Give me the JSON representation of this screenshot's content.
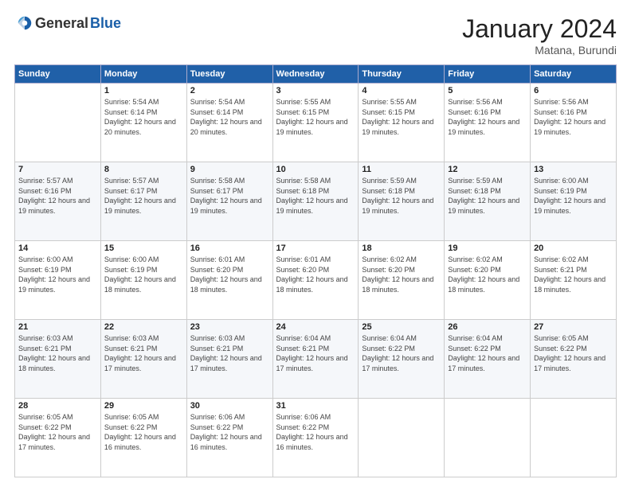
{
  "logo": {
    "general": "General",
    "blue": "Blue"
  },
  "title": "January 2024",
  "location": "Matana, Burundi",
  "weekdays": [
    "Sunday",
    "Monday",
    "Tuesday",
    "Wednesday",
    "Thursday",
    "Friday",
    "Saturday"
  ],
  "weeks": [
    [
      {
        "day": "",
        "sunrise": "",
        "sunset": "",
        "daylight": ""
      },
      {
        "day": "1",
        "sunrise": "Sunrise: 5:54 AM",
        "sunset": "Sunset: 6:14 PM",
        "daylight": "Daylight: 12 hours and 20 minutes."
      },
      {
        "day": "2",
        "sunrise": "Sunrise: 5:54 AM",
        "sunset": "Sunset: 6:14 PM",
        "daylight": "Daylight: 12 hours and 20 minutes."
      },
      {
        "day": "3",
        "sunrise": "Sunrise: 5:55 AM",
        "sunset": "Sunset: 6:15 PM",
        "daylight": "Daylight: 12 hours and 19 minutes."
      },
      {
        "day": "4",
        "sunrise": "Sunrise: 5:55 AM",
        "sunset": "Sunset: 6:15 PM",
        "daylight": "Daylight: 12 hours and 19 minutes."
      },
      {
        "day": "5",
        "sunrise": "Sunrise: 5:56 AM",
        "sunset": "Sunset: 6:16 PM",
        "daylight": "Daylight: 12 hours and 19 minutes."
      },
      {
        "day": "6",
        "sunrise": "Sunrise: 5:56 AM",
        "sunset": "Sunset: 6:16 PM",
        "daylight": "Daylight: 12 hours and 19 minutes."
      }
    ],
    [
      {
        "day": "7",
        "sunrise": "Sunrise: 5:57 AM",
        "sunset": "Sunset: 6:16 PM",
        "daylight": "Daylight: 12 hours and 19 minutes."
      },
      {
        "day": "8",
        "sunrise": "Sunrise: 5:57 AM",
        "sunset": "Sunset: 6:17 PM",
        "daylight": "Daylight: 12 hours and 19 minutes."
      },
      {
        "day": "9",
        "sunrise": "Sunrise: 5:58 AM",
        "sunset": "Sunset: 6:17 PM",
        "daylight": "Daylight: 12 hours and 19 minutes."
      },
      {
        "day": "10",
        "sunrise": "Sunrise: 5:58 AM",
        "sunset": "Sunset: 6:18 PM",
        "daylight": "Daylight: 12 hours and 19 minutes."
      },
      {
        "day": "11",
        "sunrise": "Sunrise: 5:59 AM",
        "sunset": "Sunset: 6:18 PM",
        "daylight": "Daylight: 12 hours and 19 minutes."
      },
      {
        "day": "12",
        "sunrise": "Sunrise: 5:59 AM",
        "sunset": "Sunset: 6:18 PM",
        "daylight": "Daylight: 12 hours and 19 minutes."
      },
      {
        "day": "13",
        "sunrise": "Sunrise: 6:00 AM",
        "sunset": "Sunset: 6:19 PM",
        "daylight": "Daylight: 12 hours and 19 minutes."
      }
    ],
    [
      {
        "day": "14",
        "sunrise": "Sunrise: 6:00 AM",
        "sunset": "Sunset: 6:19 PM",
        "daylight": "Daylight: 12 hours and 19 minutes."
      },
      {
        "day": "15",
        "sunrise": "Sunrise: 6:00 AM",
        "sunset": "Sunset: 6:19 PM",
        "daylight": "Daylight: 12 hours and 18 minutes."
      },
      {
        "day": "16",
        "sunrise": "Sunrise: 6:01 AM",
        "sunset": "Sunset: 6:20 PM",
        "daylight": "Daylight: 12 hours and 18 minutes."
      },
      {
        "day": "17",
        "sunrise": "Sunrise: 6:01 AM",
        "sunset": "Sunset: 6:20 PM",
        "daylight": "Daylight: 12 hours and 18 minutes."
      },
      {
        "day": "18",
        "sunrise": "Sunrise: 6:02 AM",
        "sunset": "Sunset: 6:20 PM",
        "daylight": "Daylight: 12 hours and 18 minutes."
      },
      {
        "day": "19",
        "sunrise": "Sunrise: 6:02 AM",
        "sunset": "Sunset: 6:20 PM",
        "daylight": "Daylight: 12 hours and 18 minutes."
      },
      {
        "day": "20",
        "sunrise": "Sunrise: 6:02 AM",
        "sunset": "Sunset: 6:21 PM",
        "daylight": "Daylight: 12 hours and 18 minutes."
      }
    ],
    [
      {
        "day": "21",
        "sunrise": "Sunrise: 6:03 AM",
        "sunset": "Sunset: 6:21 PM",
        "daylight": "Daylight: 12 hours and 18 minutes."
      },
      {
        "day": "22",
        "sunrise": "Sunrise: 6:03 AM",
        "sunset": "Sunset: 6:21 PM",
        "daylight": "Daylight: 12 hours and 17 minutes."
      },
      {
        "day": "23",
        "sunrise": "Sunrise: 6:03 AM",
        "sunset": "Sunset: 6:21 PM",
        "daylight": "Daylight: 12 hours and 17 minutes."
      },
      {
        "day": "24",
        "sunrise": "Sunrise: 6:04 AM",
        "sunset": "Sunset: 6:21 PM",
        "daylight": "Daylight: 12 hours and 17 minutes."
      },
      {
        "day": "25",
        "sunrise": "Sunrise: 6:04 AM",
        "sunset": "Sunset: 6:22 PM",
        "daylight": "Daylight: 12 hours and 17 minutes."
      },
      {
        "day": "26",
        "sunrise": "Sunrise: 6:04 AM",
        "sunset": "Sunset: 6:22 PM",
        "daylight": "Daylight: 12 hours and 17 minutes."
      },
      {
        "day": "27",
        "sunrise": "Sunrise: 6:05 AM",
        "sunset": "Sunset: 6:22 PM",
        "daylight": "Daylight: 12 hours and 17 minutes."
      }
    ],
    [
      {
        "day": "28",
        "sunrise": "Sunrise: 6:05 AM",
        "sunset": "Sunset: 6:22 PM",
        "daylight": "Daylight: 12 hours and 17 minutes."
      },
      {
        "day": "29",
        "sunrise": "Sunrise: 6:05 AM",
        "sunset": "Sunset: 6:22 PM",
        "daylight": "Daylight: 12 hours and 16 minutes."
      },
      {
        "day": "30",
        "sunrise": "Sunrise: 6:06 AM",
        "sunset": "Sunset: 6:22 PM",
        "daylight": "Daylight: 12 hours and 16 minutes."
      },
      {
        "day": "31",
        "sunrise": "Sunrise: 6:06 AM",
        "sunset": "Sunset: 6:22 PM",
        "daylight": "Daylight: 12 hours and 16 minutes."
      },
      {
        "day": "",
        "sunrise": "",
        "sunset": "",
        "daylight": ""
      },
      {
        "day": "",
        "sunrise": "",
        "sunset": "",
        "daylight": ""
      },
      {
        "day": "",
        "sunrise": "",
        "sunset": "",
        "daylight": ""
      }
    ]
  ]
}
